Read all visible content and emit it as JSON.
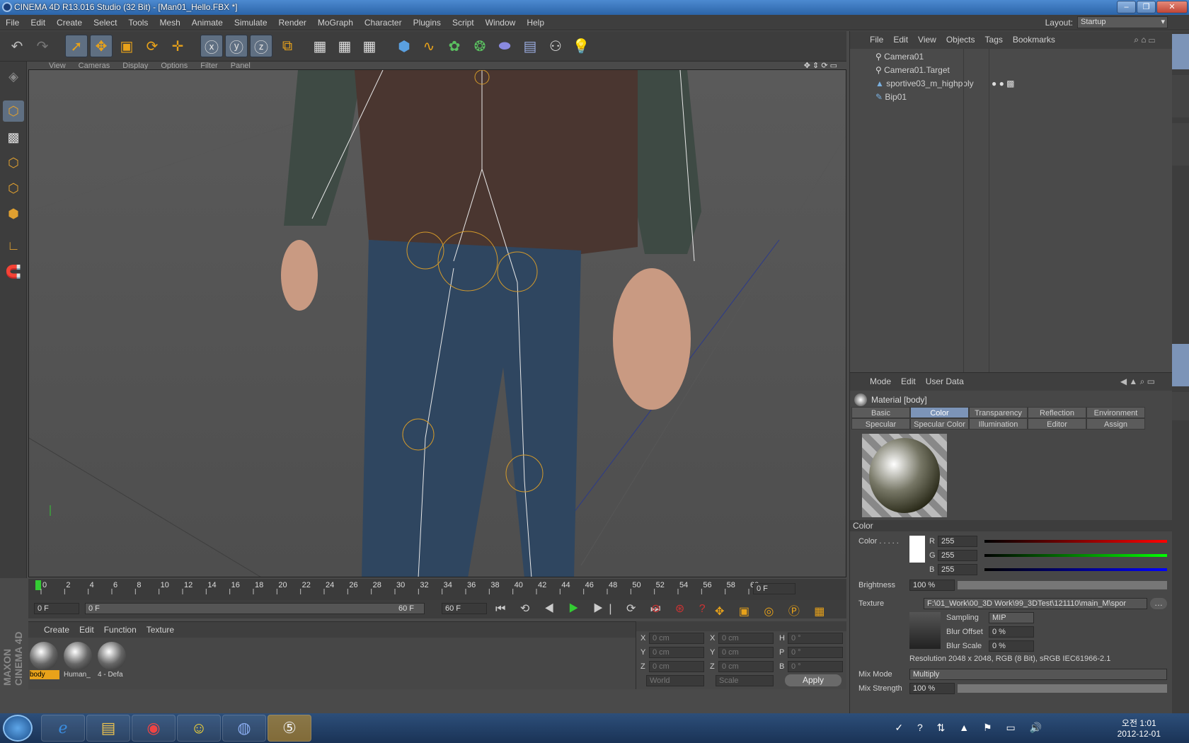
{
  "window": {
    "title": "CINEMA 4D R13.016 Studio (32 Bit) - [Man01_Hello.FBX *]"
  },
  "menu": [
    "File",
    "Edit",
    "Create",
    "Select",
    "Tools",
    "Mesh",
    "Animate",
    "Simulate",
    "Render",
    "MoGraph",
    "Character",
    "Plugins",
    "Script",
    "Window",
    "Help"
  ],
  "layout": {
    "label": "Layout:",
    "value": "Startup"
  },
  "viewport": {
    "menu": [
      "View",
      "Cameras",
      "Display",
      "Options",
      "Filter",
      "Panel"
    ]
  },
  "timeline": {
    "ticks": [
      "0",
      "2",
      "4",
      "6",
      "8",
      "10",
      "12",
      "14",
      "16",
      "18",
      "20",
      "22",
      "24",
      "26",
      "28",
      "30",
      "32",
      "34",
      "36",
      "38",
      "40",
      "42",
      "44",
      "46",
      "48",
      "50",
      "52",
      "54",
      "56",
      "58",
      "60"
    ],
    "current": "0 F",
    "start": "0 F",
    "range_start": "0 F",
    "range_end": "60 F",
    "end": "60 F"
  },
  "material_manager": {
    "menu": [
      "Create",
      "Edit",
      "Function",
      "Texture"
    ],
    "materials": [
      "body",
      "Human_",
      "4 - Defa"
    ]
  },
  "coords": {
    "rows": [
      [
        "X",
        "0 cm",
        "X",
        "0 cm",
        "H",
        "0 °"
      ],
      [
        "Y",
        "0 cm",
        "Y",
        "0 cm",
        "P",
        "0 °"
      ],
      [
        "Z",
        "0 cm",
        "Z",
        "0 cm",
        "B",
        "0 °"
      ]
    ],
    "mode1": "World",
    "mode2": "Scale",
    "apply": "Apply"
  },
  "objects": {
    "menu": [
      "File",
      "Edit",
      "View",
      "Objects",
      "Tags",
      "Bookmarks"
    ],
    "items": [
      "Camera01",
      "Camera01.Target",
      "sportive03_m_highpoly",
      "Bip01"
    ]
  },
  "attributes": {
    "menu": [
      "Mode",
      "Edit",
      "User Data"
    ],
    "title": "Material [body]",
    "tabs_row1": [
      "Basic",
      "Color",
      "Transparency",
      "Reflection",
      "Environment"
    ],
    "tabs_row2": [
      "Specular",
      "Specular Color",
      "Illumination",
      "Editor",
      "Assign"
    ],
    "section": "Color",
    "color_label": "Color . . . . .",
    "r_label": "R",
    "g_label": "G",
    "b_label": "B",
    "r": "255",
    "g": "255",
    "b": "255",
    "brightness_label": "Brightness",
    "brightness": "100 %",
    "texture_label": "Texture",
    "texture_path": "F:\\01_Work\\00_3D Work\\99_3DTest\\121110\\main_M\\spor",
    "sampling_label": "Sampling",
    "sampling": "MIP",
    "blur_offset_label": "Blur Offset",
    "blur_offset": "0 %",
    "blur_scale_label": "Blur Scale",
    "blur_scale": "0 %",
    "resolution": "Resolution 2048 x 2048, RGB (8 Bit), sRGB IEC61966-2.1",
    "mix_mode_label": "Mix Mode",
    "mix_mode": "Multiply",
    "mix_strength_label": "Mix Strength",
    "mix_strength": "100 %"
  },
  "brand": "MAXON CINEMA 4D",
  "taskbar": {
    "time": "오전 1:01",
    "date": "2012-12-01"
  },
  "colors": {
    "accent": "#e8a21a",
    "tab_active": "#7c94b8"
  }
}
